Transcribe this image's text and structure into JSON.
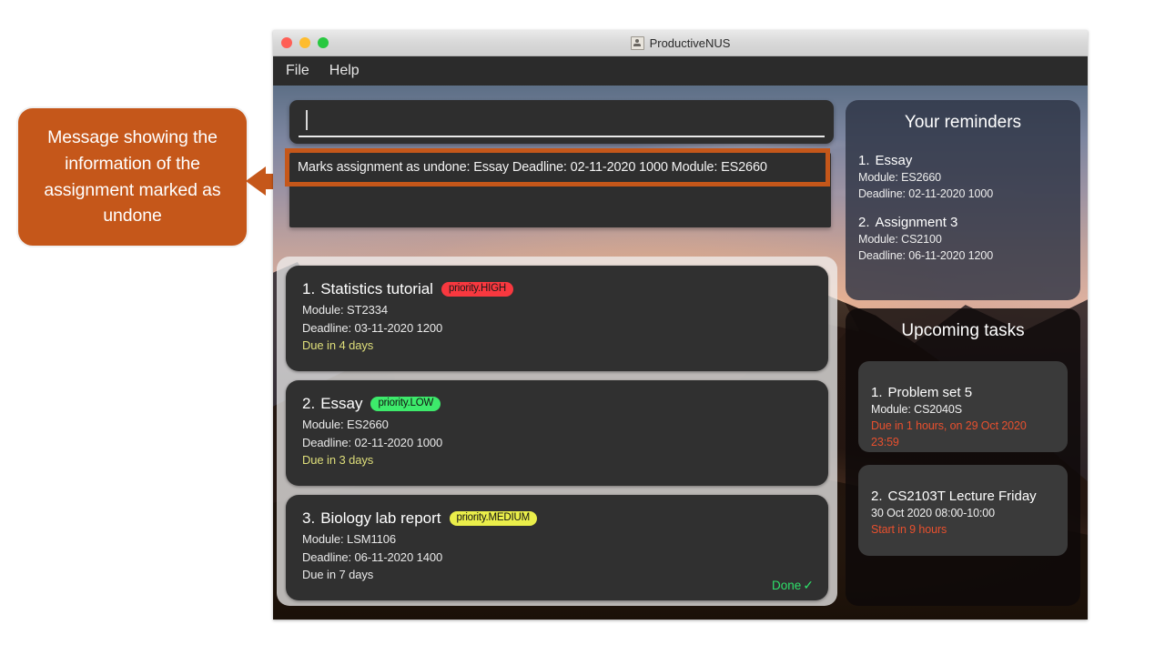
{
  "annotation": {
    "text": "Message showing the information of the assignment marked as undone",
    "color": "#c5571a"
  },
  "window": {
    "title": "ProductiveNUS",
    "app_icon": "user-icon",
    "traffic_lights": [
      "close-red",
      "minimize-yellow",
      "zoom-green"
    ],
    "menubar": [
      {
        "label": "File"
      },
      {
        "label": "Help"
      }
    ]
  },
  "command": {
    "value": "",
    "placeholder": ""
  },
  "result": {
    "text": "Marks assignment as undone: Essay Deadline: 02-11-2020 1000 Module: ES2660",
    "highlight_color": "#c5571a"
  },
  "tasks": [
    {
      "index": "1.",
      "name": "Statistics tutorial",
      "priority_label": "priority.HIGH",
      "priority_class": "high",
      "priority_color": "#f8383f",
      "module": "Module: ST2334",
      "deadline": "Deadline: 03-11-2020 1200",
      "due": "Due in 4 days",
      "due_style": "warn",
      "done": false,
      "done_label": ""
    },
    {
      "index": "2.",
      "name": "Essay",
      "priority_label": "priority.LOW",
      "priority_class": "low",
      "priority_color": "#3dea6b",
      "module": "Module: ES2660",
      "deadline": "Deadline: 02-11-2020 1000",
      "due": "Due in 3 days",
      "due_style": "warn",
      "done": false,
      "done_label": ""
    },
    {
      "index": "3.",
      "name": "Biology lab report",
      "priority_label": "priority.MEDIUM",
      "priority_class": "medium",
      "priority_color": "#eaee4a",
      "module": "Module: LSM1106",
      "deadline": "Deadline: 06-11-2020 1400",
      "due": "Due in 7 days",
      "due_style": "plain",
      "done": true,
      "done_label": "Done",
      "done_tick": "✓"
    }
  ],
  "reminders": {
    "title": "Your reminders",
    "items": [
      {
        "index": "1.",
        "name": "Essay",
        "module": "Module: ES2660",
        "deadline": "Deadline: 02-11-2020 1000"
      },
      {
        "index": "2.",
        "name": "Assignment 3",
        "module": "Module: CS2100",
        "deadline": "Deadline: 06-11-2020 1200"
      }
    ]
  },
  "upcoming": {
    "title": "Upcoming tasks",
    "items": [
      {
        "index": "1.",
        "name": "Problem set 5",
        "detail": "Module: CS2040S",
        "alert": "Due in 1 hours, on 29 Oct 2020 23:59"
      },
      {
        "index": "2.",
        "name": "CS2103T Lecture Friday",
        "detail": "30 Oct 2020 08:00-10:00",
        "alert": "Start in 9 hours"
      }
    ]
  }
}
